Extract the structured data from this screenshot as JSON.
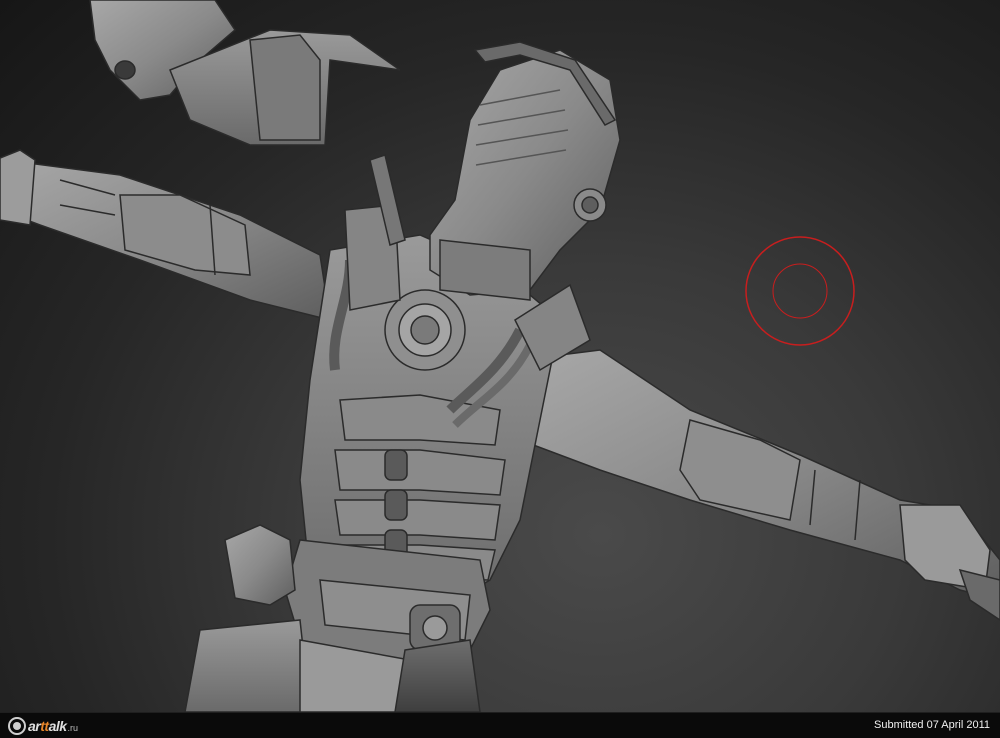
{
  "viewport": {
    "subject": "sculpt-model",
    "brush_cursor_color": "#c81e1e"
  },
  "footer": {
    "logo_prefix": "ar",
    "logo_accent": "tt",
    "logo_suffix": "alk",
    "logo_tld": ".ru",
    "submitted": "Submitted 07 April 2011"
  }
}
